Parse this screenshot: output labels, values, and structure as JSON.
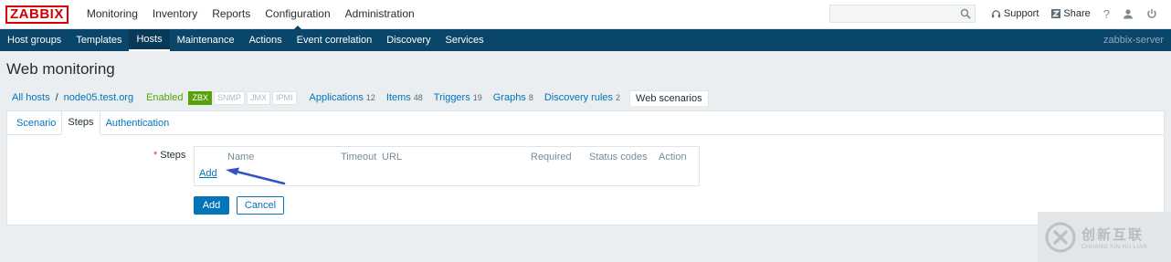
{
  "logo": "ZABBIX",
  "top_menu": [
    "Monitoring",
    "Inventory",
    "Reports",
    "Configuration",
    "Administration"
  ],
  "top_right": {
    "search_value": "",
    "support": "Support",
    "share": "Share",
    "help": "?"
  },
  "sub_menu": [
    "Host groups",
    "Templates",
    "Hosts",
    "Maintenance",
    "Actions",
    "Event correlation",
    "Discovery",
    "Services"
  ],
  "server_name": "zabbix-server",
  "page_title": "Web monitoring",
  "host_nav": {
    "all_hosts": "All hosts",
    "separator": "/",
    "host": "node05.test.org",
    "status": "Enabled",
    "badges": [
      "ZBX",
      "SNMP",
      "JMX",
      "IPMI"
    ],
    "applications": {
      "label": "Applications",
      "count": "12"
    },
    "items": {
      "label": "Items",
      "count": "48"
    },
    "triggers": {
      "label": "Triggers",
      "count": "19"
    },
    "graphs": {
      "label": "Graphs",
      "count": "8"
    },
    "discovery": {
      "label": "Discovery rules",
      "count": "2"
    },
    "current": "Web scenarios"
  },
  "form_tabs": [
    "Scenario",
    "Steps",
    "Authentication"
  ],
  "steps": {
    "required_mark": "*",
    "label": "Steps",
    "columns": [
      "Name",
      "Timeout",
      "URL",
      "Required",
      "Status codes",
      "Action"
    ],
    "add_link": "Add"
  },
  "buttons": {
    "add": "Add",
    "cancel": "Cancel"
  },
  "watermark": {
    "big": "创新互联",
    "small": "CHUANG XIN HU LIAN"
  },
  "colors": {
    "accent": "#0275b8",
    "nav": "#0a466a",
    "logo": "#d40000",
    "enabled": "#59a00d"
  }
}
